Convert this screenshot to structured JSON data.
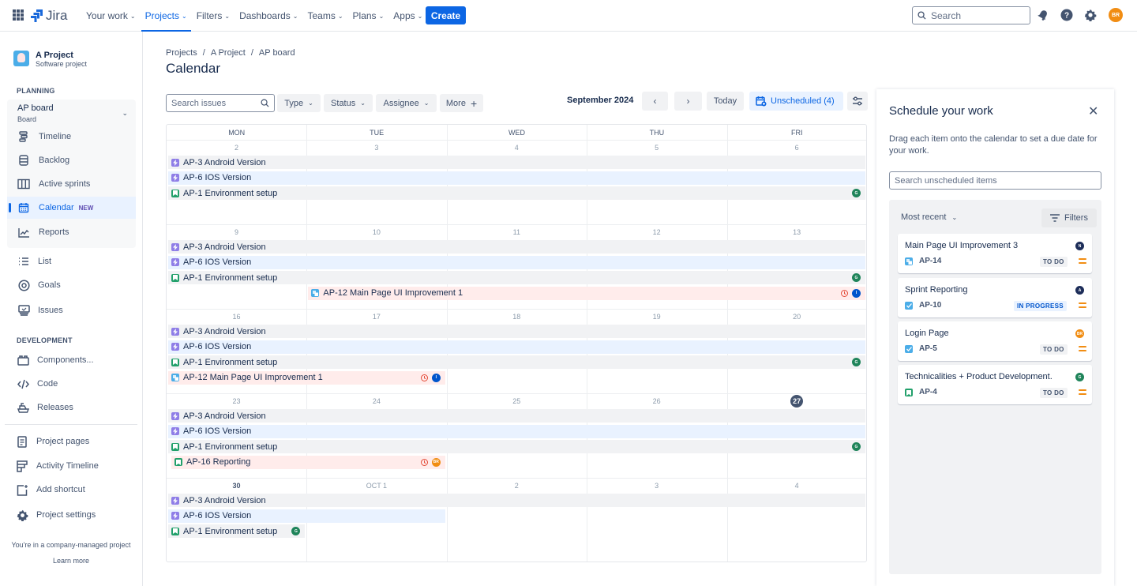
{
  "topnav": {
    "logo": "Jira",
    "items": [
      {
        "label": "Your work"
      },
      {
        "label": "Projects",
        "active": true
      },
      {
        "label": "Filters"
      },
      {
        "label": "Dashboards"
      },
      {
        "label": "Teams"
      },
      {
        "label": "Plans"
      },
      {
        "label": "Apps"
      }
    ],
    "create_label": "Create",
    "search_placeholder": "Search",
    "avatar_initials": "BR"
  },
  "sidebar": {
    "project_name": "A Project",
    "project_type": "Software project",
    "planning_heading": "PLANNING",
    "board_name": "AP board",
    "board_sub": "Board",
    "board_items": [
      {
        "label": "Timeline",
        "icon": "timeline-icon"
      },
      {
        "label": "Backlog",
        "icon": "backlog-icon"
      },
      {
        "label": "Active sprints",
        "icon": "active-sprints-icon"
      },
      {
        "label": "Calendar",
        "icon": "calendar-icon",
        "badge": "NEW",
        "selected": true
      },
      {
        "label": "Reports",
        "icon": "reports-icon"
      }
    ],
    "items": [
      {
        "label": "List",
        "icon": "list-icon"
      },
      {
        "label": "Goals",
        "icon": "goals-icon"
      },
      {
        "label": "Issues",
        "icon": "issues-icon"
      }
    ],
    "development_heading": "DEVELOPMENT",
    "dev_items": [
      {
        "label": "Components...",
        "icon": "components-icon"
      },
      {
        "label": "Code",
        "icon": "code-icon"
      },
      {
        "label": "Releases",
        "icon": "releases-icon"
      }
    ],
    "bottom_items": [
      {
        "label": "Project pages",
        "icon": "project-pages-icon"
      },
      {
        "label": "Activity Timeline",
        "icon": "activity-timeline-icon"
      },
      {
        "label": "Add shortcut",
        "icon": "add-shortcut-icon"
      },
      {
        "label": "Project settings",
        "icon": "gear-icon"
      }
    ],
    "footer_text": "You're in a company-managed project",
    "footer_link": "Learn more"
  },
  "main": {
    "breadcrumbs": [
      "Projects",
      "A Project",
      "AP board"
    ],
    "title": "Calendar",
    "search_placeholder": "Search issues",
    "filters": [
      "Type",
      "Status",
      "Assignee"
    ],
    "more_label": "More",
    "month": "September 2024",
    "today_label": "Today",
    "unscheduled_label": "Unscheduled (4)"
  },
  "calendar": {
    "days": [
      "MON",
      "TUE",
      "WED",
      "THU",
      "FRI"
    ],
    "weeks": [
      {
        "dates": [
          "2",
          "3",
          "4",
          "5",
          "6"
        ]
      },
      {
        "dates": [
          "9",
          "10",
          "11",
          "12",
          "13"
        ]
      },
      {
        "dates": [
          "16",
          "17",
          "18",
          "19",
          "20"
        ]
      },
      {
        "dates": [
          "23",
          "24",
          "25",
          "26",
          "27"
        ],
        "today_index": 4
      },
      {
        "dates": [
          "30",
          "OCT 1",
          "2",
          "3",
          "4"
        ],
        "bold_index": 0
      }
    ],
    "today": "27",
    "events": [
      {
        "week": 0,
        "row": 0,
        "start": 0,
        "end": 5,
        "key": "AP-3",
        "title": "AP-3 Android Version",
        "type": "epic",
        "color": "gray"
      },
      {
        "week": 0,
        "row": 1,
        "start": 0,
        "end": 5,
        "key": "AP-6",
        "title": "AP-6 IOS Version",
        "type": "epic",
        "color": "blue"
      },
      {
        "week": 0,
        "row": 2,
        "start": 0,
        "end": 5,
        "key": "AP-1",
        "title": "AP-1 Environment setup",
        "type": "story",
        "color": "gray",
        "avatar": "G",
        "avatar_color": "green"
      },
      {
        "week": 1,
        "row": 0,
        "start": 0,
        "end": 5,
        "title": "AP-3 Android Version",
        "type": "epic",
        "color": "gray"
      },
      {
        "week": 1,
        "row": 1,
        "start": 0,
        "end": 5,
        "title": "AP-6 IOS Version",
        "type": "epic",
        "color": "blue"
      },
      {
        "week": 1,
        "row": 2,
        "start": 0,
        "end": 5,
        "title": "AP-1 Environment setup",
        "type": "story",
        "color": "gray",
        "avatar": "G",
        "avatar_color": "green"
      },
      {
        "week": 1,
        "row": 3,
        "start": 1,
        "end": 5,
        "title": "AP-12 Main Page UI Improvement 1",
        "type": "subtask",
        "color": "red",
        "overdue": true,
        "avatar": "I",
        "avatar_color": "navy"
      },
      {
        "week": 2,
        "row": 0,
        "start": 0,
        "end": 5,
        "title": "AP-3 Android Version",
        "type": "epic",
        "color": "gray"
      },
      {
        "week": 2,
        "row": 1,
        "start": 0,
        "end": 5,
        "title": "AP-6 IOS Version",
        "type": "epic",
        "color": "blue"
      },
      {
        "week": 2,
        "row": 2,
        "start": 0,
        "end": 5,
        "title": "AP-1 Environment setup",
        "type": "story",
        "color": "gray",
        "avatar": "G",
        "avatar_color": "green"
      },
      {
        "week": 2,
        "row": 3,
        "start": 0,
        "end": 2,
        "title": "AP-12 Main Page UI Improvement 1",
        "type": "subtask",
        "color": "red",
        "overdue": true,
        "avatar": "I",
        "avatar_color": "navy"
      },
      {
        "week": 3,
        "row": 0,
        "start": 0,
        "end": 5,
        "title": "AP-3 Android Version",
        "type": "epic",
        "color": "gray"
      },
      {
        "week": 3,
        "row": 1,
        "start": 0,
        "end": 5,
        "title": "AP-6 IOS Version",
        "type": "epic",
        "color": "blue"
      },
      {
        "week": 3,
        "row": 2,
        "start": 0,
        "end": 5,
        "title": "AP-1 Environment setup",
        "type": "story",
        "color": "gray",
        "avatar": "G",
        "avatar_color": "green"
      },
      {
        "week": 3,
        "row": 3,
        "start": 0,
        "end": 2,
        "title": "AP-16 Reporting",
        "type": "story",
        "color": "red",
        "overdue": true,
        "avatar": "BR",
        "avatar_color": "orange",
        "inset": true
      },
      {
        "week": 4,
        "row": 0,
        "start": 0,
        "end": 5,
        "title": "AP-3 Android Version",
        "type": "epic",
        "color": "gray"
      },
      {
        "week": 4,
        "row": 1,
        "start": 0,
        "end": 2,
        "title": "AP-6 IOS Version",
        "type": "epic",
        "color": "blue"
      },
      {
        "week": 4,
        "row": 2,
        "start": 0,
        "end": 1,
        "title": "AP-1 Environment setup",
        "type": "story",
        "color": "gray",
        "avatar": "G",
        "avatar_color": "green"
      }
    ]
  },
  "panel": {
    "title": "Schedule your work",
    "description": "Drag each item onto the calendar to set a due date for your work.",
    "search_placeholder": "Search unscheduled items",
    "sort_label": "Most recent",
    "filters_label": "Filters",
    "cards": [
      {
        "title": "Main Page UI Improvement 3",
        "key": "AP-14",
        "type": "subtask",
        "status": "TO DO",
        "avatar": "N",
        "avatar_color": "#1d2d59"
      },
      {
        "title": "Sprint Reporting",
        "key": "AP-10",
        "type": "task",
        "status": "IN PROGRESS",
        "avatar": "A",
        "avatar_color": "#1d2d59"
      },
      {
        "title": "Login Page",
        "key": "AP-5",
        "type": "task",
        "status": "TO DO",
        "avatar": "BR",
        "avatar_color": "#f18d13"
      },
      {
        "title": "Technicalities + Product Development.",
        "key": "AP-4",
        "type": "story",
        "status": "TO DO",
        "avatar": "G",
        "avatar_color": "#1f845a"
      }
    ]
  }
}
